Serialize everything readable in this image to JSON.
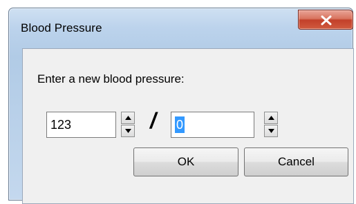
{
  "window": {
    "title": "Blood Pressure"
  },
  "dialog": {
    "prompt": "Enter a new blood pressure:",
    "systolic_value": "123",
    "diastolic_value": "0",
    "separator": "/",
    "ok_label": "OK",
    "cancel_label": "Cancel"
  },
  "icons": {
    "close": "close-icon",
    "spin_up": "arrow-up-icon",
    "spin_down": "arrow-down-icon"
  },
  "colors": {
    "close_button": "#c94a33",
    "selection": "#3399ff",
    "title_bar": "#bcd3ec",
    "client_background": "#f0f0f0"
  }
}
